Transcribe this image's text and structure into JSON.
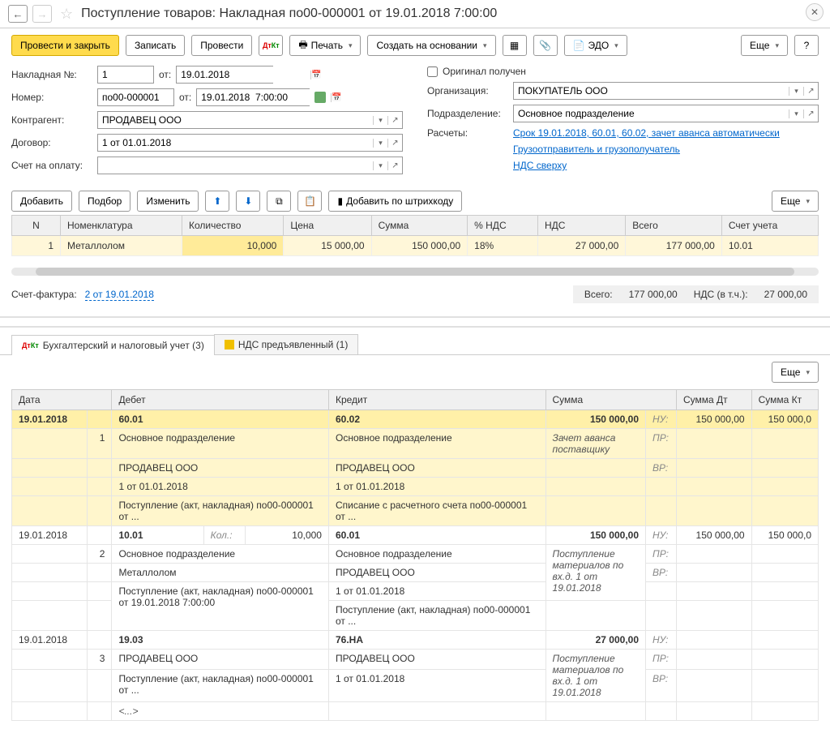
{
  "title": "Поступление товаров: Накладная по00-000001 от 19.01.2018 7:00:00",
  "toolbar": {
    "post_close": "Провести и закрыть",
    "save": "Записать",
    "post": "Провести",
    "print": "Печать",
    "create_based": "Создать на основании",
    "edo": "ЭДО",
    "more": "Еще",
    "help": "?"
  },
  "form": {
    "invoice_no_label": "Накладная №:",
    "invoice_no": "1",
    "from_label": "от:",
    "invoice_date": "19.01.2018",
    "original_received": "Оригинал получен",
    "number_label": "Номер:",
    "number": "по00-000001",
    "datetime": "19.01.2018  7:00:00",
    "org_label": "Организация:",
    "org": "ПОКУПАТЕЛЬ ООО",
    "contractor_label": "Контрагент:",
    "contractor": "ПРОДАВЕЦ ООО",
    "division_label": "Подразделение:",
    "division": "Основное подразделение",
    "contract_label": "Договор:",
    "contract": "1 от 01.01.2018",
    "settlements_label": "Расчеты:",
    "settlements_link": "Срок 19.01.2018, 60.01, 60.02, зачет аванса автоматически",
    "account_label": "Счет на оплату:",
    "account": "",
    "shipper_link": "Грузоотправитель и грузополучатель",
    "vat_link": "НДС сверху"
  },
  "table_toolbar": {
    "add": "Добавить",
    "select": "Подбор",
    "edit": "Изменить",
    "add_barcode": "Добавить по штрихкоду",
    "more": "Еще"
  },
  "items_headers": {
    "n": "N",
    "nomenclature": "Номенклатура",
    "qty": "Количество",
    "price": "Цена",
    "sum": "Сумма",
    "vat_pct": "% НДС",
    "vat": "НДС",
    "total": "Всего",
    "account": "Счет учета"
  },
  "items": [
    {
      "n": "1",
      "name": "Металлолом",
      "qty": "10,000",
      "price": "15 000,00",
      "sum": "150 000,00",
      "vat_pct": "18%",
      "vat": "27 000,00",
      "total": "177 000,00",
      "account": "10.01"
    }
  ],
  "invoice_label": "Счет-фактура:",
  "invoice_link": "2 от 19.01.2018",
  "totals": {
    "total_label": "Всего:",
    "total": "177 000,00",
    "vat_label": "НДС (в т.ч.):",
    "vat": "27 000,00"
  },
  "tabs": {
    "accounting": "Бухгалтерский и налоговый учет (3)",
    "vat": "НДС предъявленный (1)"
  },
  "acc_headers": {
    "date": "Дата",
    "debit": "Дебет",
    "credit": "Кредит",
    "sum": "Сумма",
    "sum_dt": "Сумма Дт",
    "sum_kt": "Сумма Кт"
  },
  "acc": {
    "labels": {
      "nu": "НУ:",
      "pr": "ПР:",
      "vr": "ВР:",
      "qty": "Кол.:"
    },
    "r1": {
      "date": "19.01.2018",
      "n": "1",
      "debit_acc": "60.01",
      "credit_acc": "60.02",
      "sum": "150 000,00",
      "sum_dt": "150 000,00",
      "sum_kt": "150 000,0",
      "d_div": "Основное подразделение",
      "d_cntr": "ПРОДАВЕЦ ООО",
      "d_contract": "1 от 01.01.2018",
      "d_doc": "Поступление (акт, накладная) по00-000001 от ...",
      "c_div": "Основное подразделение",
      "c_cntr": "ПРОДАВЕЦ ООО",
      "c_contract": "1 от 01.01.2018",
      "c_doc": "Списание с расчетного счета по00-000001 от ...",
      "descr": "Зачет аванса поставщику"
    },
    "r2": {
      "date": "19.01.2018",
      "n": "2",
      "debit_acc": "10.01",
      "credit_acc": "60.01",
      "sum": "150 000,00",
      "qty": "10,000",
      "sum_dt": "150 000,00",
      "sum_kt": "150 000,0",
      "d_div": "Основное подразделение",
      "d_item": "Металлолом",
      "d_doc": "Поступление (акт, накладная) по00-000001 от 19.01.2018 7:00:00",
      "c_div": "Основное подразделение",
      "c_cntr": "ПРОДАВЕЦ ООО",
      "c_contract": "1 от 01.01.2018",
      "c_doc": "Поступление (акт, накладная) по00-000001 от ...",
      "descr": "Поступление материалов по вх.д. 1 от 19.01.2018"
    },
    "r3": {
      "date": "19.01.2018",
      "n": "3",
      "debit_acc": "19.03",
      "credit_acc": "76.НА",
      "sum": "27 000,00",
      "d_cntr": "ПРОДАВЕЦ ООО",
      "c_cntr": "ПРОДАВЕЦ ООО",
      "c_contract": "1 от 01.01.2018",
      "d_doc": "Поступление (акт, накладная) по00-000001 от ...",
      "d_more": "<...>",
      "descr": "Поступление материалов по вх.д. 1 от 19.01.2018"
    }
  }
}
